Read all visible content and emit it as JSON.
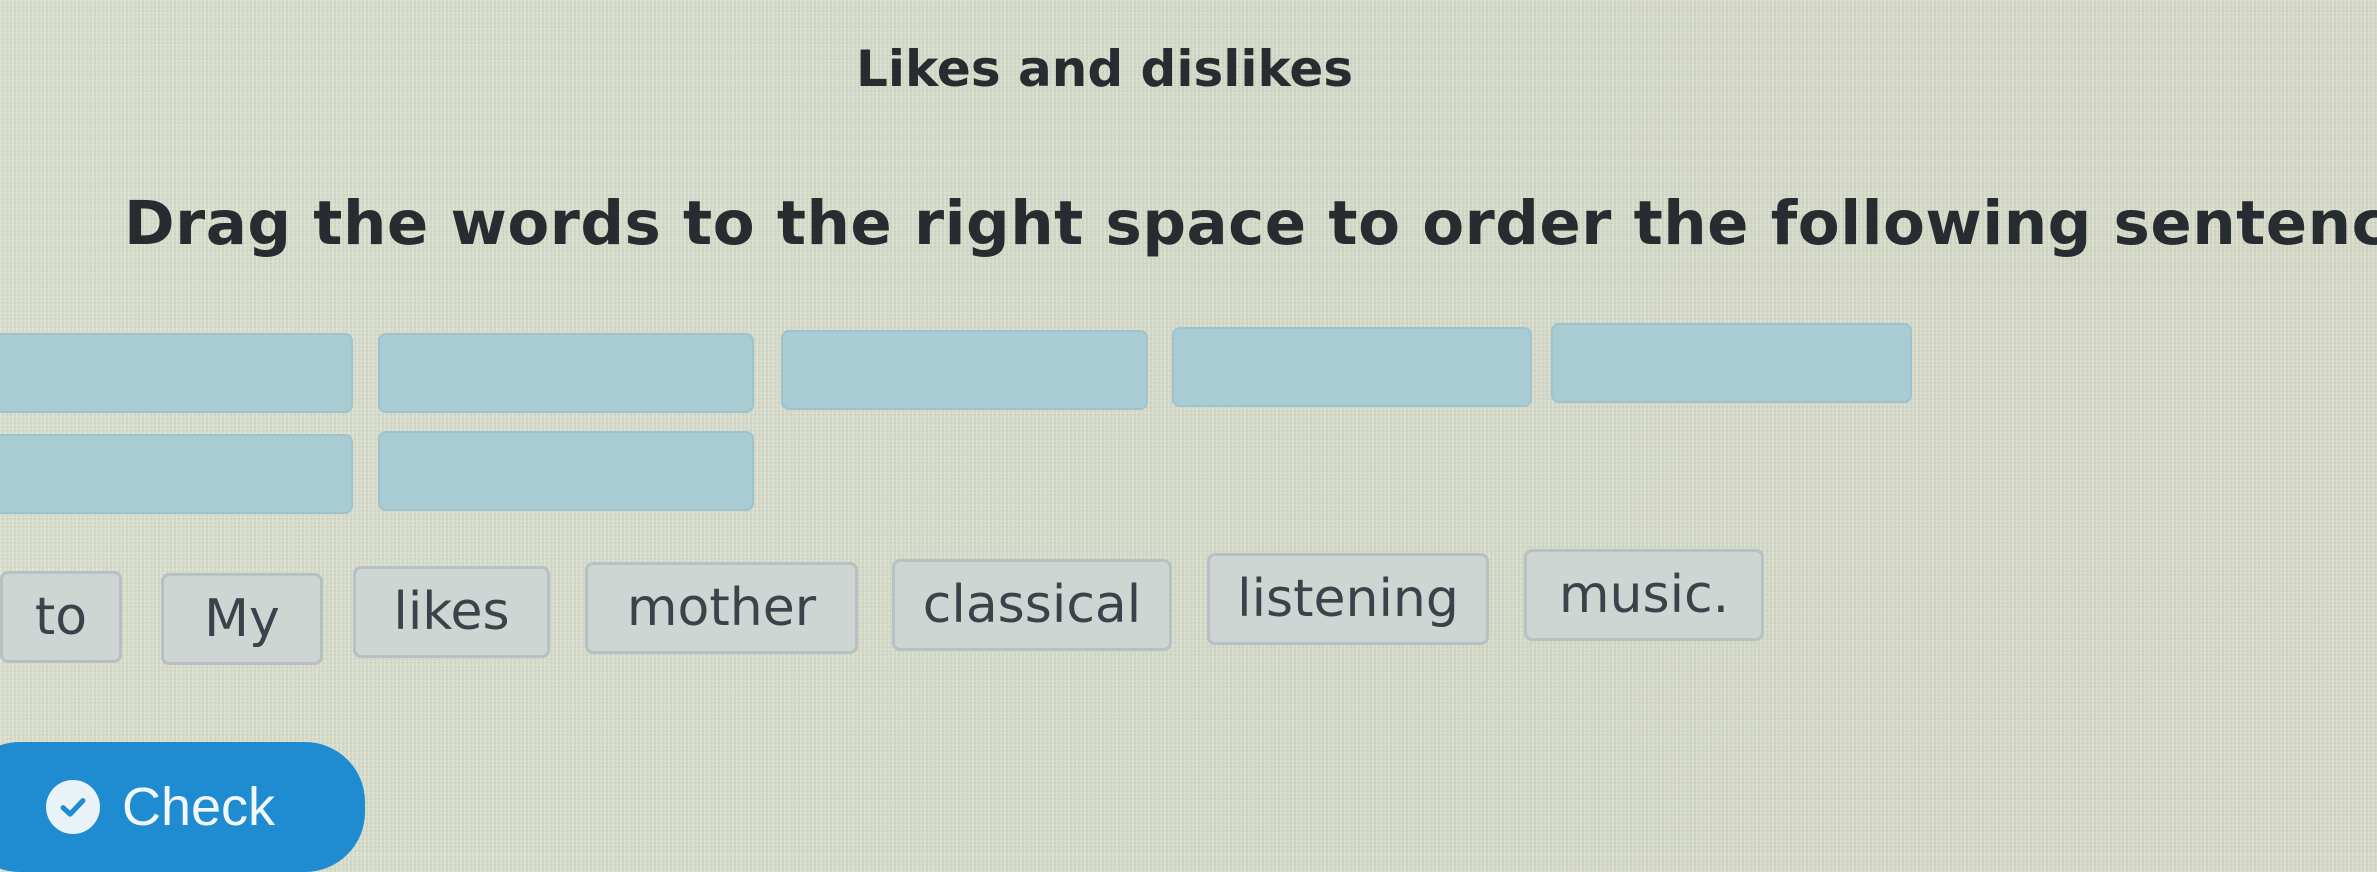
{
  "title": "Likes and dislikes",
  "instruction": "Drag the words to the right space to order the following sentences",
  "answer_slots": [
    "",
    "",
    "",
    "",
    "",
    "",
    ""
  ],
  "word_bank": [
    "to",
    "My",
    "likes",
    "mother",
    "classical",
    "listening",
    "music."
  ],
  "check_button": {
    "label": "Check",
    "icon": "check-circle-icon"
  },
  "colors": {
    "slot": "#a9cbd4",
    "word_tile": "#ced5d3",
    "button": "#1f8bd0"
  }
}
